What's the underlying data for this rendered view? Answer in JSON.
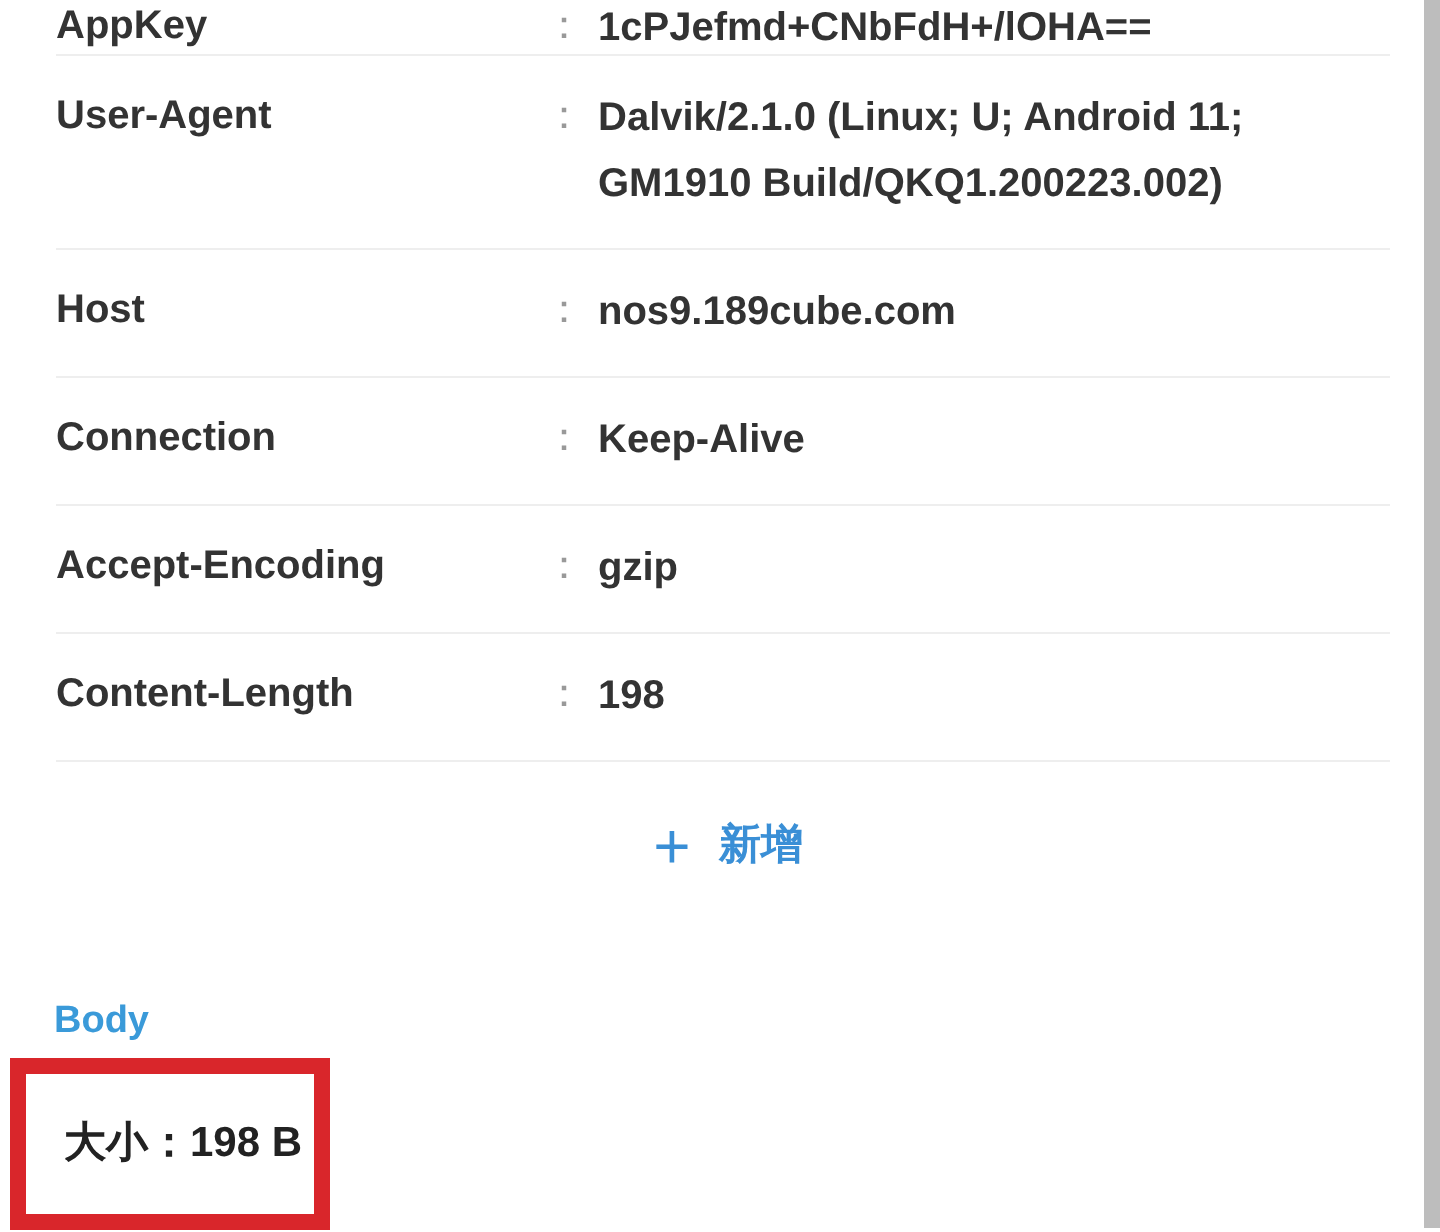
{
  "headers": [
    {
      "name": "AppKey",
      "value": "1cPJefmd+CNbFdH+/lOHA=="
    },
    {
      "name": "User-Agent",
      "value": "Dalvik/2.1.0 (Linux; U; Android 11; GM1910 Build/QKQ1.200223.002)"
    },
    {
      "name": "Host",
      "value": "nos9.189cube.com"
    },
    {
      "name": "Connection",
      "value": "Keep-Alive"
    },
    {
      "name": "Accept-Encoding",
      "value": "gzip"
    },
    {
      "name": "Content-Length",
      "value": "198"
    }
  ],
  "separator": "：",
  "add_button": {
    "icon": "+",
    "label": "新增"
  },
  "body": {
    "title": "Body",
    "size": "大小：198 B"
  }
}
